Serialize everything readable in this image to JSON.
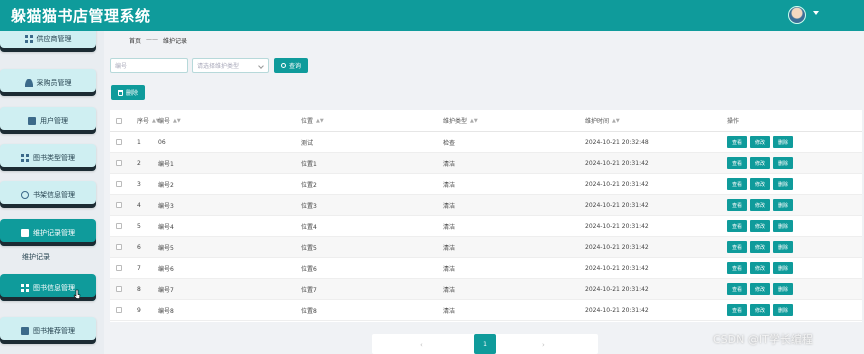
{
  "header": {
    "title": "躲猫猫书店管理系统"
  },
  "sidebar": {
    "items": [
      {
        "label": "供应商管理",
        "icon": "grid-icon"
      },
      {
        "label": "采购员管理",
        "icon": "user-icon"
      },
      {
        "label": "用户管理",
        "icon": "square-icon"
      },
      {
        "label": "图书类型管理",
        "icon": "grid-icon"
      },
      {
        "label": "书架信息管理",
        "icon": "scissor-icon"
      },
      {
        "label": "维护记录管理",
        "icon": "square-icon",
        "active": true
      },
      {
        "label": "图书信息管理",
        "icon": "grid-icon",
        "active": true
      },
      {
        "label": "图书推荐管理",
        "icon": "square-icon"
      }
    ],
    "sub_items": [
      {
        "label": "维护记录"
      }
    ]
  },
  "breadcrumb": {
    "home": "首页",
    "separator": "——",
    "current": "维护记录"
  },
  "filters": {
    "number_placeholder": "编号",
    "type_placeholder": "请选择维护类型",
    "search_label": "查询",
    "delete_label": "删除"
  },
  "table": {
    "columns": [
      "序号",
      "编号",
      "位置",
      "维护类型",
      "维护时间",
      "操作"
    ],
    "rows": [
      {
        "seq": "1",
        "code": "06",
        "location": "测试",
        "type": "检查",
        "time": "2024-10-21 20:32:48"
      },
      {
        "seq": "2",
        "code": "编号1",
        "location": "位置1",
        "type": "清洁",
        "time": "2024-10-21 20:31:42"
      },
      {
        "seq": "3",
        "code": "编号2",
        "location": "位置2",
        "type": "清洁",
        "time": "2024-10-21 20:31:42"
      },
      {
        "seq": "4",
        "code": "编号3",
        "location": "位置3",
        "type": "清洁",
        "time": "2024-10-21 20:31:42"
      },
      {
        "seq": "5",
        "code": "编号4",
        "location": "位置4",
        "type": "清洁",
        "time": "2024-10-21 20:31:42"
      },
      {
        "seq": "6",
        "code": "编号5",
        "location": "位置5",
        "type": "清洁",
        "time": "2024-10-21 20:31:42"
      },
      {
        "seq": "7",
        "code": "编号6",
        "location": "位置6",
        "type": "清洁",
        "time": "2024-10-21 20:31:42"
      },
      {
        "seq": "8",
        "code": "编号7",
        "location": "位置7",
        "type": "清洁",
        "time": "2024-10-21 20:31:42"
      },
      {
        "seq": "9",
        "code": "编号8",
        "location": "位置8",
        "type": "清洁",
        "time": "2024-10-21 20:31:42"
      }
    ],
    "actions": {
      "view": "查看",
      "edit": "修改",
      "delete": "删除"
    }
  },
  "pagination": {
    "prev": "‹",
    "current": "1",
    "next": "›"
  },
  "watermark": "CSDN @IT学长编程",
  "colors": {
    "accent": "#0f9b9b",
    "sidebar_bg": "#e9edf1"
  }
}
